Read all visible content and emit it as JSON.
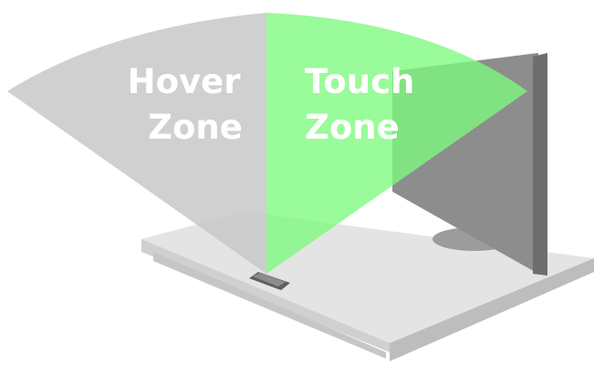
{
  "labels": {
    "hover_line1": "Hover",
    "hover_line2": "Zone",
    "touch_line1": "Touch",
    "touch_line2": "Zone"
  },
  "colors": {
    "hover_zone": "#c8c8c8",
    "touch_zone": "#7dfa7d",
    "monitor": "#8a8a8a",
    "desk_top": "#e2e2e2",
    "desk_edge": "#cfcfcf",
    "label_text": "#ffffff"
  }
}
